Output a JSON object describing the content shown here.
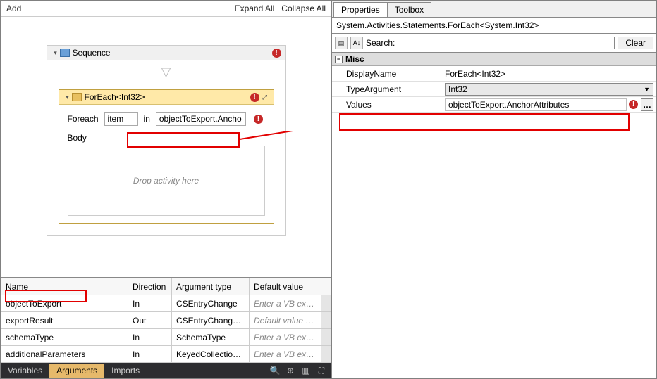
{
  "left": {
    "add": "Add",
    "expand_all": "Expand All",
    "collapse_all": "Collapse All"
  },
  "sequence": {
    "title": "Sequence"
  },
  "foreach": {
    "title": "ForEach<Int32>",
    "foreach_label": "Foreach",
    "item_value": "item",
    "in_label": "in",
    "in_expr": "objectToExport.Anchor",
    "body_label": "Body",
    "drop_hint": "Drop activity here"
  },
  "args": {
    "headers": {
      "name": "Name",
      "direction": "Direction",
      "type": "Argument type",
      "default": "Default value"
    },
    "rows": [
      {
        "name": "objectToExport",
        "direction": "In",
        "type": "CSEntryChange",
        "default": "Enter a VB express",
        "placeholder": true
      },
      {
        "name": "exportResult",
        "direction": "Out",
        "type": "CSEntryChangeRes",
        "default": "Default value not su",
        "placeholder": true
      },
      {
        "name": "schemaType",
        "direction": "In",
        "type": "SchemaType",
        "default": "Enter a VB express",
        "placeholder": true
      },
      {
        "name": "additionalParameters",
        "direction": "In",
        "type": "KeyedCollection<S",
        "default": "Enter a VB express",
        "placeholder": true
      }
    ]
  },
  "bottom_tabs": {
    "variables": "Variables",
    "arguments": "Arguments",
    "imports": "Imports"
  },
  "right_tabs": {
    "properties": "Properties",
    "toolbox": "Toolbox"
  },
  "scope": "System.Activities.Statements.ForEach<System.Int32>",
  "search": {
    "label": "Search:",
    "clear": "Clear"
  },
  "misc": {
    "label": "Misc",
    "displayname": {
      "name": "DisplayName",
      "value": "ForEach<Int32>"
    },
    "typearg": {
      "name": "TypeArgument",
      "value": "Int32"
    },
    "values": {
      "name": "Values",
      "value": "objectToExport.AnchorAttributes"
    }
  }
}
